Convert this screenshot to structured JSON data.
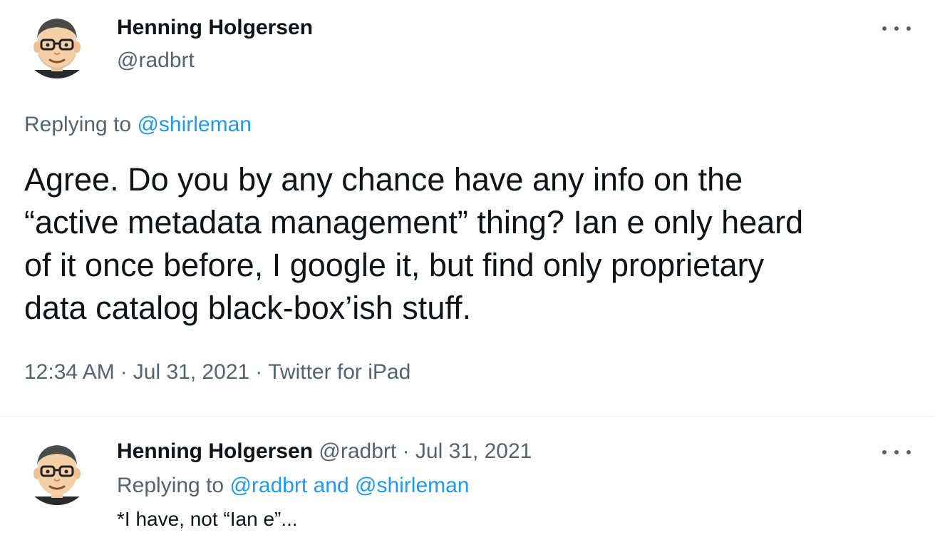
{
  "main_tweet": {
    "author": {
      "display_name": "Henning Holgersen",
      "handle": "@radbrt"
    },
    "replying_to": {
      "prefix": "Replying to",
      "mention": "@shirleman"
    },
    "text_lines": [
      "Agree. Do you by any chance have any info on the",
      "“active metadata management” thing? Ian e only heard",
      "of it once before, I google it, but find only proprietary",
      "data catalog black-box’ish stuff."
    ],
    "time": "12:34 AM",
    "date": "Jul 31, 2021",
    "source": "Twitter for iPad",
    "separator": "·"
  },
  "reply_tweet": {
    "author": {
      "display_name": "Henning Holgersen",
      "handle": "@radbrt"
    },
    "separator": "·",
    "date": "Jul 31, 2021",
    "replying_to": {
      "prefix": "Replying to",
      "mention": "@radbrt and @shirleman"
    },
    "text": "*I have, not “Ian e”..."
  },
  "icons": {
    "avatar": "cartoon-man-with-glasses",
    "more": "more-options-icon"
  },
  "colors": {
    "text_primary": "#0f1419",
    "text_secondary": "#536471",
    "link": "#1d9bf0",
    "divider": "#eff3f4"
  }
}
